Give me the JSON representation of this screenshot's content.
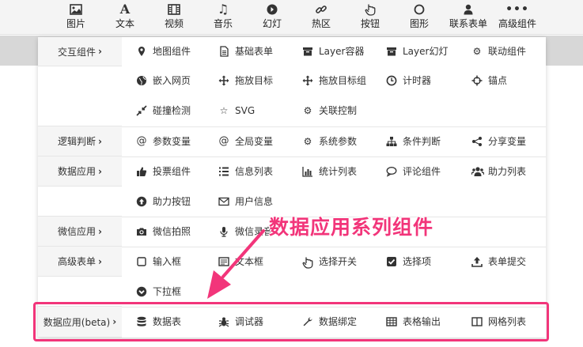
{
  "toolbar": {
    "items": [
      {
        "label": "图片",
        "icon": "image-icon"
      },
      {
        "label": "文本",
        "icon": "text-icon"
      },
      {
        "label": "视频",
        "icon": "film-icon"
      },
      {
        "label": "音乐",
        "icon": "music-icon"
      },
      {
        "label": "幻灯",
        "icon": "slideshow-icon"
      },
      {
        "label": "热区",
        "icon": "link-icon"
      },
      {
        "label": "按钮",
        "icon": "hand-pointer-icon"
      },
      {
        "label": "图形",
        "icon": "circle-icon"
      },
      {
        "label": "联系表单",
        "icon": "user-icon"
      },
      {
        "label": "高级组件",
        "icon": "more-icon"
      }
    ]
  },
  "panel": {
    "categories": [
      {
        "label": "交互组件",
        "arrow": "›"
      },
      {
        "label": "逻辑判断",
        "arrow": "›"
      },
      {
        "label": "数据应用",
        "arrow": "›"
      },
      {
        "label": "微信应用",
        "arrow": "›"
      },
      {
        "label": "高级表单",
        "arrow": "›"
      },
      {
        "label": "数据应用(beta)",
        "arrow": "›"
      }
    ],
    "items": {
      "interactive": [
        {
          "label": "地图组件",
          "icon": "map-marker-icon"
        },
        {
          "label": "基础表单",
          "icon": "file-text-icon"
        },
        {
          "label": "Layer容器",
          "icon": "archive-icon"
        },
        {
          "label": "Layer幻灯",
          "icon": "archive-icon"
        },
        {
          "label": "联动组件",
          "icon": "gears-icon"
        },
        {
          "label": "嵌入网页",
          "icon": "globe-icon"
        },
        {
          "label": "拖放目标",
          "icon": "move-icon"
        },
        {
          "label": "拖放目标组",
          "icon": "move-icon"
        },
        {
          "label": "计时器",
          "icon": "clock-icon"
        },
        {
          "label": "锚点",
          "icon": "crosshairs-icon"
        },
        {
          "label": "碰撞检测",
          "icon": "compress-icon"
        },
        {
          "label": "SVG",
          "icon": "star-outline-icon"
        },
        {
          "label": "关联控制",
          "icon": "gears-icon"
        }
      ],
      "logic": [
        {
          "label": "参数变量",
          "icon": "at-icon"
        },
        {
          "label": "全局变量",
          "icon": "at-icon"
        },
        {
          "label": "系统参数",
          "icon": "cog-icon"
        },
        {
          "label": "条件判断",
          "icon": "sitemap-icon"
        },
        {
          "label": "分享变量",
          "icon": "share-icon"
        }
      ],
      "data": [
        {
          "label": "投票组件",
          "icon": "thumbs-up-icon"
        },
        {
          "label": "信息列表",
          "icon": "list-icon"
        },
        {
          "label": "统计列表",
          "icon": "bar-chart-icon"
        },
        {
          "label": "评论组件",
          "icon": "comment-icon"
        },
        {
          "label": "助力列表",
          "icon": "users-icon"
        },
        {
          "label": "助力按钮",
          "icon": "arrow-circle-up-icon"
        },
        {
          "label": "用户信息",
          "icon": "envelope-icon"
        }
      ],
      "wechat": [
        {
          "label": "微信拍照",
          "icon": "camera-icon"
        },
        {
          "label": "微信录音",
          "icon": "microphone-icon"
        }
      ],
      "advanced_form": [
        {
          "label": "输入框",
          "icon": "square-outline-icon"
        },
        {
          "label": "文本框",
          "icon": "textbox-icon"
        },
        {
          "label": "选择开关",
          "icon": "hand-pointer-icon"
        },
        {
          "label": "选择项",
          "icon": "check-square-icon"
        },
        {
          "label": "表单提交",
          "icon": "upload-icon"
        },
        {
          "label": "下拉框",
          "icon": "chevron-circle-down-icon"
        }
      ],
      "data_beta": [
        {
          "label": "数据表",
          "icon": "database-icon"
        },
        {
          "label": "调试器",
          "icon": "bug-icon"
        },
        {
          "label": "数据绑定",
          "icon": "wrench-icon"
        },
        {
          "label": "表格输出",
          "icon": "table-icon"
        },
        {
          "label": "网格列表",
          "icon": "columns-icon"
        }
      ]
    }
  },
  "annotation": {
    "callout": "数据应用系列组件",
    "color": "#f2357a"
  }
}
